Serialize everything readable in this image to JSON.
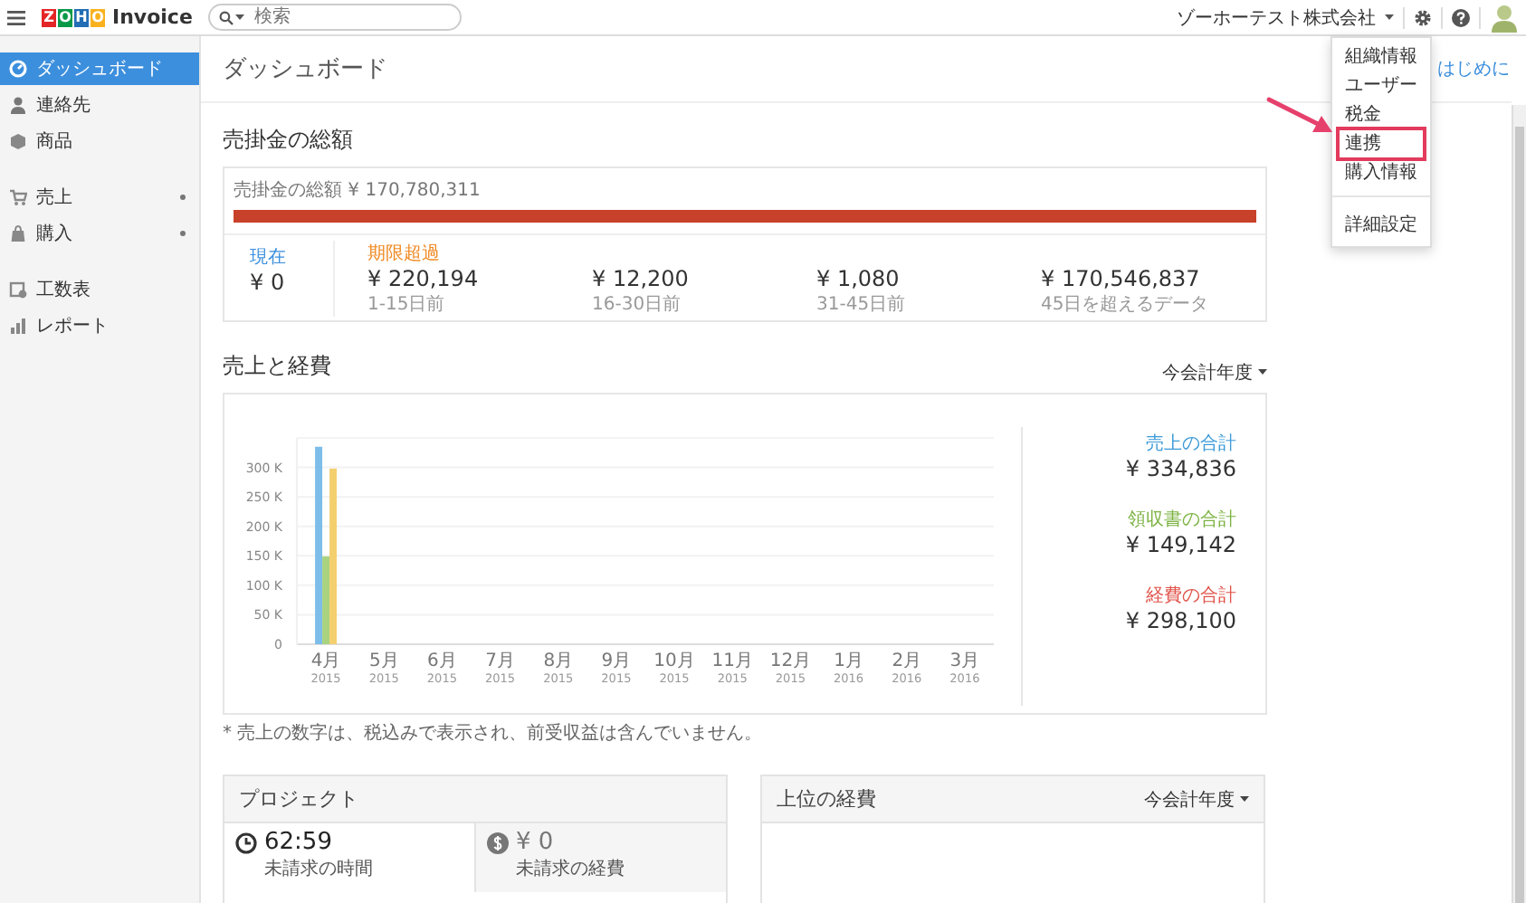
{
  "top_bar": {
    "logo": {
      "letters": [
        {
          "char": "Z",
          "color": "#e42527"
        },
        {
          "char": "O",
          "color": "#089949"
        },
        {
          "char": "H",
          "color": "#226db4"
        },
        {
          "char": "O",
          "color": "#f9b21d"
        }
      ],
      "product": "Invoice"
    },
    "search": {
      "placeholder": "検索"
    },
    "organization": "ゾーホーテスト株式会社"
  },
  "settings_menu": {
    "groups": [
      [
        {
          "label": "組織情報",
          "highlighted": false
        },
        {
          "label": "ユーザー",
          "highlighted": false
        },
        {
          "label": "税金",
          "highlighted": false
        },
        {
          "label": "連携",
          "highlighted": true
        },
        {
          "label": "購入情報",
          "highlighted": false
        }
      ],
      [
        {
          "label": "詳細設定",
          "highlighted": false
        }
      ]
    ]
  },
  "sidebar": {
    "groups": [
      [
        {
          "label": "ダッシュボード",
          "selected": true,
          "has_submenu": false
        },
        {
          "label": "連絡先",
          "selected": false,
          "has_submenu": false
        },
        {
          "label": "商品",
          "selected": false,
          "has_submenu": false
        }
      ],
      [
        {
          "label": "売上",
          "selected": false,
          "has_submenu": true
        },
        {
          "label": "購入",
          "selected": false,
          "has_submenu": true
        }
      ],
      [
        {
          "label": "工数表",
          "selected": false,
          "has_submenu": false
        },
        {
          "label": "レポート",
          "selected": false,
          "has_submenu": false
        }
      ]
    ]
  },
  "page": {
    "title": "ダッシュボード",
    "help_link": "はじめに"
  },
  "receivables": {
    "title": "売掛金の総額",
    "total": "売掛金の総額 ¥ 170,780,311",
    "bar": {
      "level": 1
    },
    "current": {
      "label": "現在",
      "amount": "¥ 0"
    },
    "overdue": {
      "label": "期限超過",
      "buckets": [
        {
          "amount": "¥ 220,194",
          "range": "1-15日前"
        },
        {
          "amount": "¥ 12,200",
          "range": "16-30日前"
        },
        {
          "amount": "¥ 1,080",
          "range": "31-45日前"
        },
        {
          "amount": "¥ 170,546,837",
          "range": "45日を超えるデータ"
        }
      ]
    }
  },
  "sales_expenses": {
    "title": "売上と経費",
    "period": "今会計年度",
    "chart_data": {
      "type": "bar",
      "categories": [
        "4月 2015",
        "5月 2015",
        "6月 2015",
        "7月 2015",
        "8月 2015",
        "9月 2015",
        "10月 2015",
        "11月 2015",
        "12月 2015",
        "1月 2016",
        "2月 2016",
        "3月 2016"
      ],
      "series": [
        {
          "color": "#7cbde9",
          "values": [
            335000,
            0,
            0,
            0,
            0,
            0,
            0,
            0,
            0,
            0,
            0,
            0
          ]
        },
        {
          "color": "#a9d37f",
          "values": [
            149000,
            0,
            0,
            0,
            0,
            0,
            0,
            0,
            0,
            0,
            0,
            0
          ]
        },
        {
          "color": "#f3cf6e",
          "values": [
            298000,
            0,
            0,
            0,
            0,
            0,
            0,
            0,
            0,
            0,
            0,
            0
          ]
        }
      ],
      "grid": true,
      "ylim": [
        0,
        350000
      ],
      "yticks": [
        {
          "value": 0,
          "label": "0"
        },
        {
          "value": 50000,
          "label": "50 K"
        },
        {
          "value": 100000,
          "label": "100 K"
        },
        {
          "value": 150000,
          "label": "150 K"
        },
        {
          "value": 200000,
          "label": "200 K"
        },
        {
          "value": 250000,
          "label": "250 K"
        },
        {
          "value": 300000,
          "label": "300 K"
        }
      ]
    },
    "totals": [
      {
        "label": "売上の合計",
        "amount": "¥ 334,836",
        "color": "#3d9ad8"
      },
      {
        "label": "領収書の合計",
        "amount": "¥ 149,142",
        "color": "#7cb342"
      },
      {
        "label": "経費の合計",
        "amount": "¥ 298,100",
        "color": "#e0534a"
      }
    ],
    "footnote": "* 売上の数字は、税込みで表示され、前受収益は含んでいません。"
  },
  "projects": {
    "title": "プロジェクト",
    "stats": [
      {
        "kind": "time",
        "value": "62:59",
        "label": "未請求の時間"
      },
      {
        "kind": "money",
        "value": "¥ 0",
        "label": "未請求の経費"
      }
    ]
  },
  "top_expenses": {
    "title": "上位の経費",
    "period": "今会計年度"
  }
}
